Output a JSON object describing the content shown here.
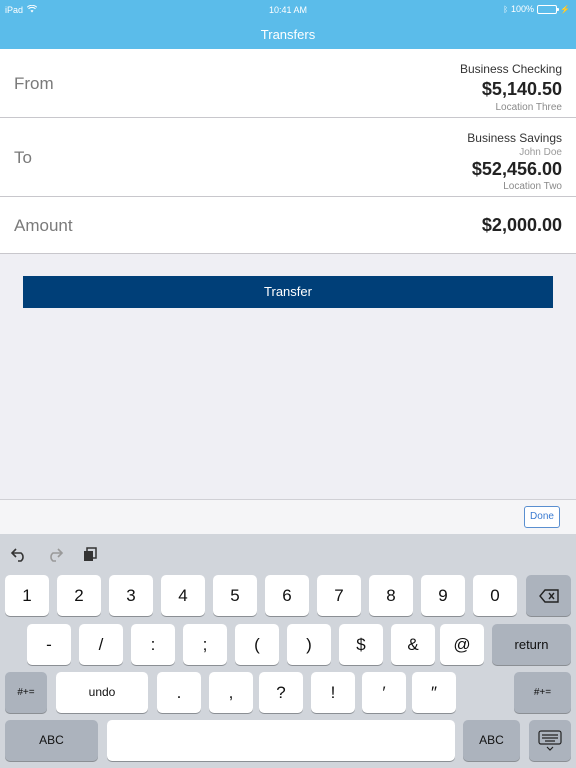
{
  "status": {
    "device": "iPad",
    "time": "10:41 AM",
    "battery": "100%"
  },
  "nav": {
    "title": "Transfers"
  },
  "from": {
    "label": "From",
    "account": "Business Checking",
    "balance": "$5,140.50",
    "location": "Location Three"
  },
  "to": {
    "label": "To",
    "account": "Business Savings",
    "owner": "John Doe",
    "balance": "$52,456.00",
    "location": "Location Two"
  },
  "amount": {
    "label": "Amount",
    "value": "$2,000.00"
  },
  "transfer_label": "Transfer",
  "accessory": {
    "done_label": "Done"
  },
  "keyboard": {
    "row1": [
      "1",
      "2",
      "3",
      "4",
      "5",
      "6",
      "7",
      "8",
      "9",
      "0"
    ],
    "row2": [
      "-",
      "/",
      ":",
      ";",
      "(",
      ")",
      "$",
      "&",
      "@"
    ],
    "return_label": "return",
    "row3": [
      ".",
      ",",
      "?",
      "!",
      "′",
      "″"
    ],
    "symbols_label": "#+=",
    "undo_label": "undo",
    "abc_label": "ABC",
    "icons": [
      "undo-arrow-icon",
      "redo-arrow-icon",
      "paste-icon",
      "delete-icon",
      "keyboard-dismiss-icon"
    ]
  }
}
